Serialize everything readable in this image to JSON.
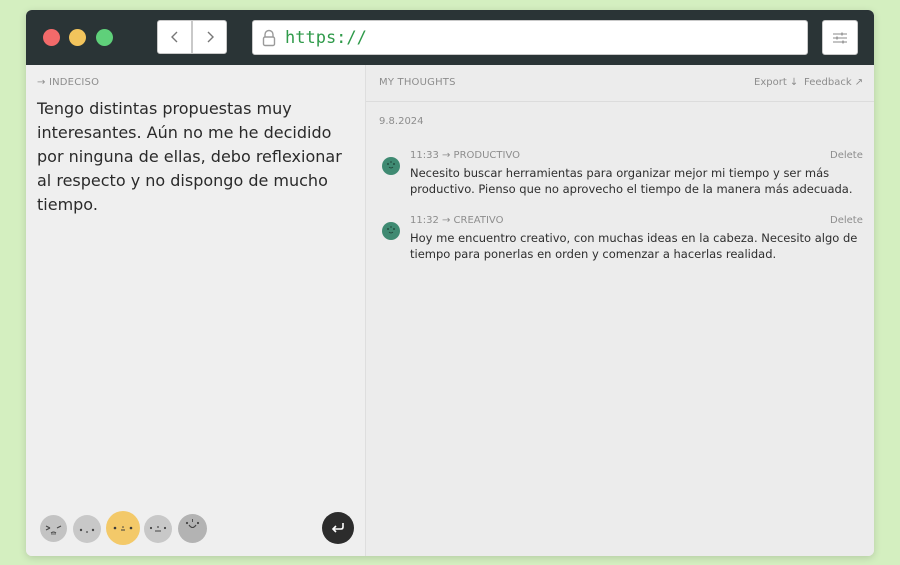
{
  "browser": {
    "url": "https://",
    "back_icon": "chevron-left-icon",
    "forward_icon": "chevron-right-icon",
    "lock_icon": "lock-icon",
    "settings_icon": "sliders-icon"
  },
  "entry": {
    "mood_label": "→ INDECISO",
    "text": "Tengo distintas propuestas muy interesantes. Aún no me he decidido por ninguna de ellas, debo reflexionar al respecto y no dispongo de mucho tiempo.",
    "selected_face_index": 2,
    "submit_icon": "enter-arrow-icon"
  },
  "thoughts": {
    "title": "MY THOUGHTS",
    "export_label": "Export ↓",
    "feedback_label": "Feedback ↗",
    "date": "9.8.2024",
    "items": [
      {
        "meta": "11:33 → PRODUCTIVO",
        "delete_label": "Delete",
        "text": "Necesito buscar herramientas para organizar mejor mi tiempo y ser más productivo. Pienso que no aprovecho el tiempo de la manera más adecuada."
      },
      {
        "meta": "11:32 → CREATIVO",
        "delete_label": "Delete",
        "text": "Hoy me encuentro creativo, con muchas ideas en la cabeza. Necesito algo de tiempo para ponerlas en orden y comenzar a hacerlas realidad."
      }
    ]
  },
  "colors": {
    "background": "#d4efc0",
    "titlebar": "#2a3436",
    "url_text": "#2f9a4a",
    "selected_face": "#f3c969",
    "face_grey": "#c3c3c3",
    "avatar_green": "#3f8a72",
    "submit_button": "#2c2c2c"
  }
}
